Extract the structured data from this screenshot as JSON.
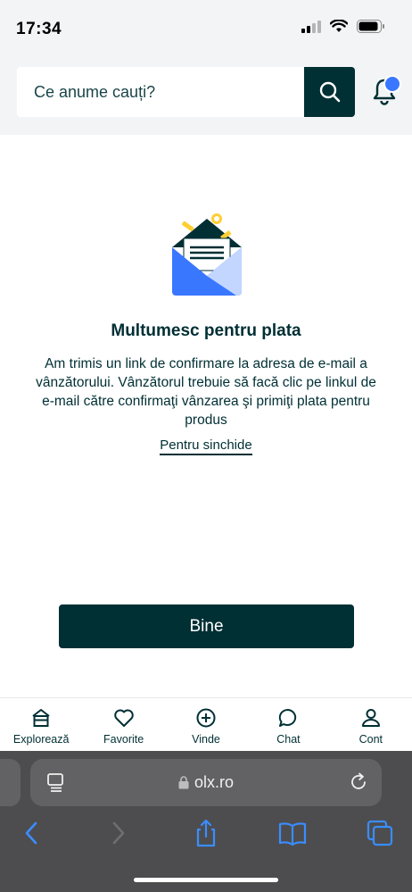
{
  "status_bar": {
    "time": "17:34"
  },
  "header": {
    "search": {
      "placeholder": "Ce anume cauți?"
    }
  },
  "main": {
    "title": "Multumesc pentru plata",
    "message": "Am trimis un link de confirmare la adresa de e-mail a vânzătorului. Vânzătorul trebuie să facă clic pe linkul de e-mail către confirmaţi vânzarea şi primiţi plata pentru produs",
    "close_link": "Pentru sinchide",
    "ok_button": "Bine"
  },
  "bottom_nav": {
    "items": [
      {
        "label": "Explorează",
        "icon": "home-icon"
      },
      {
        "label": "Favorite",
        "icon": "heart-icon"
      },
      {
        "label": "Vinde",
        "icon": "plus-circle-icon"
      },
      {
        "label": "Chat",
        "icon": "chat-bubble-icon"
      },
      {
        "label": "Cont",
        "icon": "user-icon"
      }
    ]
  },
  "browser": {
    "url": "olx.ro"
  },
  "colors": {
    "brand_dark": "#002f34",
    "notification_dot": "#3a77ff",
    "envelope_blue": "#3a77ff",
    "accent_yellow": "#ffce32"
  }
}
